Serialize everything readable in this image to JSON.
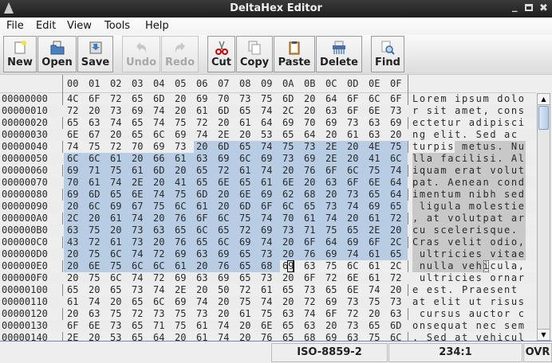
{
  "window": {
    "title": "DeltaHex Editor"
  },
  "menu": [
    "File",
    "Edit",
    "View",
    "Tools",
    "Help"
  ],
  "toolbar": {
    "new": "New",
    "open": "Open",
    "save": "Save",
    "undo": "Undo",
    "redo": "Redo",
    "cut": "Cut",
    "copy": "Copy",
    "paste": "Paste",
    "delete": "Delete",
    "find": "Find"
  },
  "columns": [
    "00",
    "01",
    "02",
    "03",
    "04",
    "05",
    "06",
    "07",
    "08",
    "09",
    "0A",
    "0B",
    "0C",
    "0D",
    "0E",
    "0F"
  ],
  "selection": {
    "start": 70,
    "end": 233,
    "cursor": 234
  },
  "colors": {
    "selection_hex": "#b8cde4",
    "selection_text": "#c8c8c8"
  },
  "rows": [
    {
      "offset": "00000000",
      "hex": "4C 6F 72 65 6D 20 69 70 73 75 6D 20 64 6F 6C 6F",
      "ascii": "Lorem ipsum dolo"
    },
    {
      "offset": "00000010",
      "hex": "72 20 73 69 74 20 61 6D 65 74 2C 20 63 6F 6E 73",
      "ascii": "r sit amet, cons"
    },
    {
      "offset": "00000020",
      "hex": "65 63 74 65 74 75 72 20 61 64 69 70 69 73 63 69",
      "ascii": "ectetur adipisci"
    },
    {
      "offset": "00000030",
      "hex": "6E 67 20 65 6C 69 74 2E 20 53 65 64 20 61 63 20",
      "ascii": "ng elit. Sed ac "
    },
    {
      "offset": "00000040",
      "hex": "74 75 72 70 69 73 20 6D 65 74 75 73 2E 20 4E 75",
      "ascii": "turpis metus. Nu"
    },
    {
      "offset": "00000050",
      "hex": "6C 6C 61 20 66 61 63 69 6C 69 73 69 2E 20 41 6C",
      "ascii": "lla facilisi. Al"
    },
    {
      "offset": "00000060",
      "hex": "69 71 75 61 6D 20 65 72 61 74 20 76 6F 6C 75 74",
      "ascii": "iquam erat volut"
    },
    {
      "offset": "00000070",
      "hex": "70 61 74 2E 20 41 65 6E 65 61 6E 20 63 6F 6E 64",
      "ascii": "pat. Aenean cond"
    },
    {
      "offset": "00000080",
      "hex": "69 6D 65 6E 74 75 6D 20 6E 69 62 68 20 73 65 64",
      "ascii": "imentum nibh sed"
    },
    {
      "offset": "00000090",
      "hex": "20 6C 69 67 75 6C 61 20 6D 6F 6C 65 73 74 69 65",
      "ascii": " ligula molestie"
    },
    {
      "offset": "000000A0",
      "hex": "2C 20 61 74 20 76 6F 6C 75 74 70 61 74 20 61 72",
      "ascii": ", at volutpat ar"
    },
    {
      "offset": "000000B0",
      "hex": "63 75 20 73 63 65 6C 65 72 69 73 71 75 65 2E 20",
      "ascii": "cu scelerisque. "
    },
    {
      "offset": "000000C0",
      "hex": "43 72 61 73 20 76 65 6C 69 74 20 6F 64 69 6F 2C",
      "ascii": "Cras velit odio,"
    },
    {
      "offset": "000000D0",
      "hex": "20 75 6C 74 72 69 63 69 65 73 20 76 69 74 61 65",
      "ascii": " ultricies vitae"
    },
    {
      "offset": "000000E0",
      "hex": "20 6E 75 6C 6C 61 20 76 65 68 69 63 75 6C 61 2C",
      "ascii": " nulla vehicula,"
    },
    {
      "offset": "000000F0",
      "hex": "20 75 6C 74 72 69 63 69 65 73 20 6F 72 6E 61 72",
      "ascii": " ultricies ornar"
    },
    {
      "offset": "00000100",
      "hex": "65 20 65 73 74 2E 20 50 72 61 65 73 65 6E 74 20",
      "ascii": "e est. Praesent "
    },
    {
      "offset": "00000110",
      "hex": "61 74 20 65 6C 69 74 20 75 74 20 72 69 73 75 73",
      "ascii": "at elit ut risus"
    },
    {
      "offset": "00000120",
      "hex": "20 63 75 72 73 75 73 20 61 75 63 74 6F 72 20 63",
      "ascii": " cursus auctor c"
    },
    {
      "offset": "00000130",
      "hex": "6F 6E 73 65 71 75 61 74 20 6E 65 63 20 73 65 6D",
      "ascii": "onsequat nec sem"
    },
    {
      "offset": "00000140",
      "hex": "2E 20 53 65 64 20 61 74 20 76 65 68 69 63 75 6C",
      "ascii": ". Sed at vehicul"
    }
  ],
  "status": {
    "encoding": "ISO-8859-2",
    "position": "234:1",
    "mode": "OVR"
  }
}
